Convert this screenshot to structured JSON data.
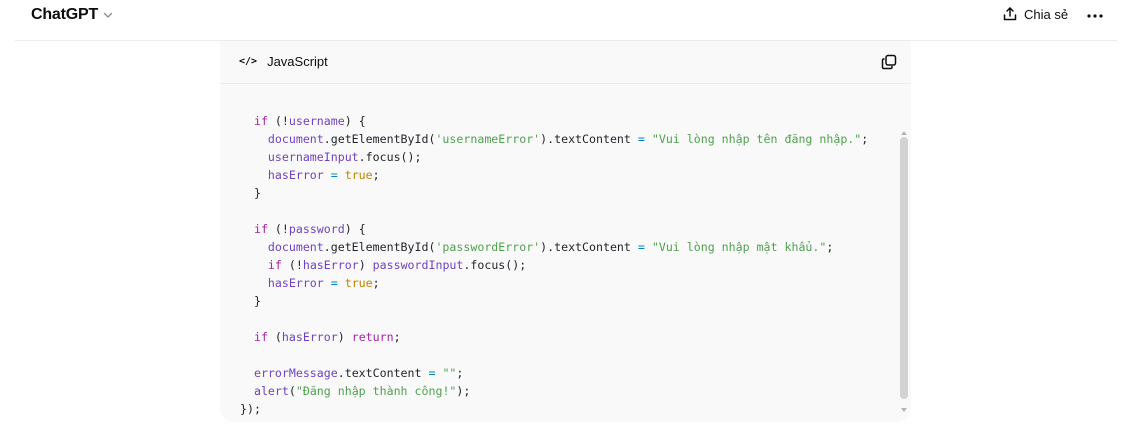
{
  "header": {
    "title": "ChatGPT",
    "share_label": "Chia sẻ"
  },
  "icons": {
    "title_chevron": "chevron-down-icon",
    "share": "share-upload-icon",
    "more": "more-horizontal-icon",
    "code": "code-icon",
    "copy": "copy-icon"
  },
  "code_block": {
    "language": "JavaScript",
    "lines": [
      [
        {
          "t": "plain",
          "v": "    "
        },
        {
          "t": "plain",
          "v": "             "
        }
      ],
      [
        {
          "t": "plain",
          "v": ""
        }
      ],
      [
        {
          "t": "plain",
          "v": "  "
        },
        {
          "t": "kw",
          "v": "if"
        },
        {
          "t": "plain",
          "v": " (!"
        },
        {
          "t": "var",
          "v": "username"
        },
        {
          "t": "plain",
          "v": ") {"
        }
      ],
      [
        {
          "t": "plain",
          "v": "    "
        },
        {
          "t": "obj",
          "v": "document"
        },
        {
          "t": "plain",
          "v": ".getElementById("
        },
        {
          "t": "str",
          "v": "'usernameError'"
        },
        {
          "t": "plain",
          "v": ").textContent "
        },
        {
          "t": "op",
          "v": "="
        },
        {
          "t": "plain",
          "v": " "
        },
        {
          "t": "str",
          "v": "\"Vui lòng nhập tên đăng nhập.\""
        },
        {
          "t": "plain",
          "v": ";"
        }
      ],
      [
        {
          "t": "plain",
          "v": "    "
        },
        {
          "t": "var",
          "v": "usernameInput"
        },
        {
          "t": "plain",
          "v": ".focus();"
        }
      ],
      [
        {
          "t": "plain",
          "v": "    "
        },
        {
          "t": "var",
          "v": "hasError"
        },
        {
          "t": "plain",
          "v": " "
        },
        {
          "t": "op",
          "v": "="
        },
        {
          "t": "plain",
          "v": " "
        },
        {
          "t": "bool",
          "v": "true"
        },
        {
          "t": "plain",
          "v": ";"
        }
      ],
      [
        {
          "t": "plain",
          "v": "  }"
        }
      ],
      [
        {
          "t": "plain",
          "v": ""
        }
      ],
      [
        {
          "t": "plain",
          "v": "  "
        },
        {
          "t": "kw",
          "v": "if"
        },
        {
          "t": "plain",
          "v": " (!"
        },
        {
          "t": "var",
          "v": "password"
        },
        {
          "t": "plain",
          "v": ") {"
        }
      ],
      [
        {
          "t": "plain",
          "v": "    "
        },
        {
          "t": "obj",
          "v": "document"
        },
        {
          "t": "plain",
          "v": ".getElementById("
        },
        {
          "t": "str",
          "v": "'passwordError'"
        },
        {
          "t": "plain",
          "v": ").textContent "
        },
        {
          "t": "op",
          "v": "="
        },
        {
          "t": "plain",
          "v": " "
        },
        {
          "t": "str",
          "v": "\"Vui lòng nhập mật khẩu.\""
        },
        {
          "t": "plain",
          "v": ";"
        }
      ],
      [
        {
          "t": "plain",
          "v": "    "
        },
        {
          "t": "kw",
          "v": "if"
        },
        {
          "t": "plain",
          "v": " (!"
        },
        {
          "t": "var",
          "v": "hasError"
        },
        {
          "t": "plain",
          "v": ") "
        },
        {
          "t": "var",
          "v": "passwordInput"
        },
        {
          "t": "plain",
          "v": ".focus();"
        }
      ],
      [
        {
          "t": "plain",
          "v": "    "
        },
        {
          "t": "var",
          "v": "hasError"
        },
        {
          "t": "plain",
          "v": " "
        },
        {
          "t": "op",
          "v": "="
        },
        {
          "t": "plain",
          "v": " "
        },
        {
          "t": "bool",
          "v": "true"
        },
        {
          "t": "plain",
          "v": ";"
        }
      ],
      [
        {
          "t": "plain",
          "v": "  }"
        }
      ],
      [
        {
          "t": "plain",
          "v": ""
        }
      ],
      [
        {
          "t": "plain",
          "v": "  "
        },
        {
          "t": "kw",
          "v": "if"
        },
        {
          "t": "plain",
          "v": " ("
        },
        {
          "t": "var",
          "v": "hasError"
        },
        {
          "t": "plain",
          "v": ") "
        },
        {
          "t": "kw",
          "v": "return"
        },
        {
          "t": "plain",
          "v": ";"
        }
      ],
      [
        {
          "t": "plain",
          "v": ""
        }
      ],
      [
        {
          "t": "plain",
          "v": "  "
        },
        {
          "t": "var",
          "v": "errorMessage"
        },
        {
          "t": "plain",
          "v": ".textContent "
        },
        {
          "t": "op",
          "v": "="
        },
        {
          "t": "plain",
          "v": " "
        },
        {
          "t": "str",
          "v": "\"\""
        },
        {
          "t": "plain",
          "v": ";"
        }
      ],
      [
        {
          "t": "plain",
          "v": "  "
        },
        {
          "t": "var",
          "v": "alert"
        },
        {
          "t": "plain",
          "v": "("
        },
        {
          "t": "str",
          "v": "\"Đăng nhập thành công!\""
        },
        {
          "t": "plain",
          "v": ");"
        }
      ],
      [
        {
          "t": "plain",
          "v": "});"
        }
      ]
    ]
  },
  "colors": {
    "keyword": "#a626a4",
    "variable": "#6f42c1",
    "string": "#50a14f",
    "boolean": "#c18401",
    "operator": "#0184bc",
    "code_background": "#f9f9f9"
  }
}
